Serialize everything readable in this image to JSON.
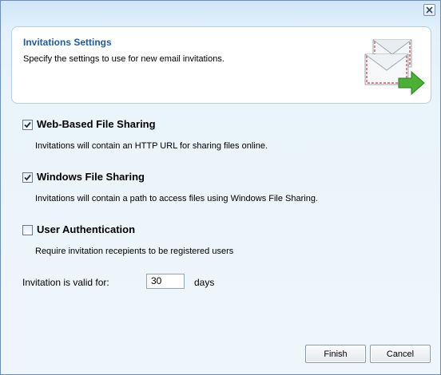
{
  "dialog": {
    "close_icon": "close-icon"
  },
  "header": {
    "title": "Invitations Settings",
    "subtitle": "Specify the settings to use for new email invitations.",
    "icon": "envelopes-arrow-icon"
  },
  "options": [
    {
      "label": "Web-Based File Sharing",
      "description": "Invitations will contain an HTTP URL for sharing files online.",
      "checked": true
    },
    {
      "label": "Windows File Sharing",
      "description": "Invitations will contain a path to access files using Windows File Sharing.",
      "checked": true
    },
    {
      "label": "User Authentication",
      "description": "Require invitation recepients to be registered users",
      "checked": false
    }
  ],
  "validity": {
    "label": "Invitation is valid for:",
    "value": "30",
    "unit": "days"
  },
  "buttons": {
    "finish": "Finish",
    "cancel": "Cancel"
  },
  "colors": {
    "title_blue": "#1e5c9e",
    "window_border": "#6d8fb5"
  }
}
